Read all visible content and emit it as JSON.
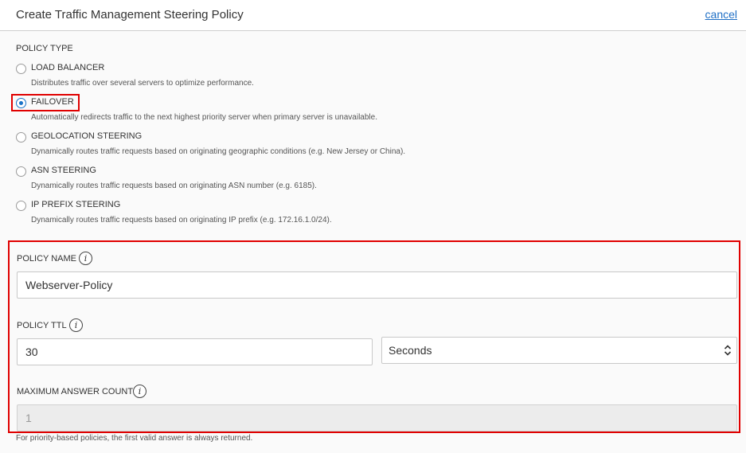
{
  "header": {
    "title": "Create Traffic Management Steering Policy",
    "cancel_label": "cancel"
  },
  "policy_type": {
    "label": "POLICY TYPE",
    "selected": "FAILOVER",
    "options": [
      {
        "label": "LOAD BALANCER",
        "description": "Distributes traffic over several servers to optimize performance."
      },
      {
        "label": "FAILOVER",
        "description": "Automatically redirects traffic to the next highest priority server when primary server is unavailable."
      },
      {
        "label": "GEOLOCATION STEERING",
        "description": "Dynamically routes traffic requests based on originating geographic conditions (e.g. New Jersey or China)."
      },
      {
        "label": "ASN STEERING",
        "description": "Dynamically routes traffic requests based on originating ASN number (e.g. 6185)."
      },
      {
        "label": "IP PREFIX STEERING",
        "description": "Dynamically routes traffic requests based on originating IP prefix (e.g. 172.16.1.0/24)."
      }
    ]
  },
  "form": {
    "policy_name": {
      "label": "POLICY NAME",
      "value": "Webserver-Policy"
    },
    "policy_ttl": {
      "label": "POLICY TTL",
      "value": "30",
      "unit": "Seconds"
    },
    "max_answer_count": {
      "label": "MAXIMUM ANSWER COUNT",
      "value": "1"
    },
    "footnote": "For priority-based policies, the first valid answer is always returned."
  },
  "colors": {
    "accent": "#1a73c7",
    "highlight": "#e00000",
    "link": "#1f6fc5"
  },
  "icons": {
    "info": "info-icon"
  }
}
